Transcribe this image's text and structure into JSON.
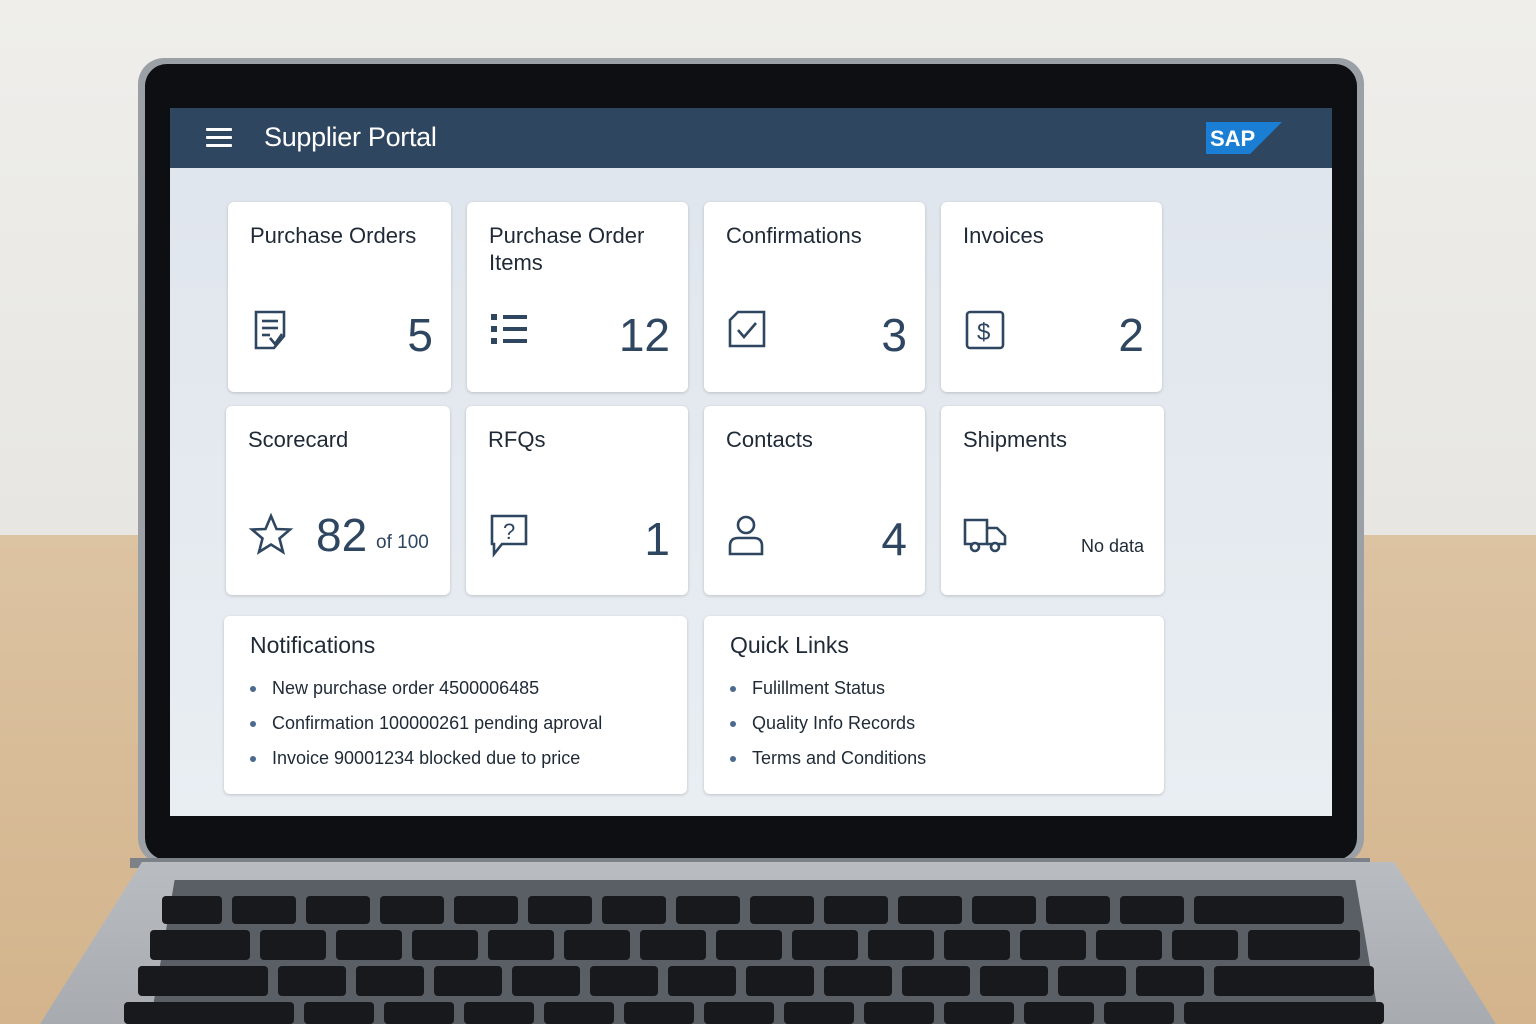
{
  "app": {
    "title": "Supplier Portal",
    "logo_text": "SAP"
  },
  "tiles_row1": [
    {
      "title": "Purchase Orders",
      "value": "5",
      "icon": "document-icon"
    },
    {
      "title": "Purchase Order Items",
      "value": "12",
      "icon": "list-icon"
    },
    {
      "title": "Confirmations",
      "value": "3",
      "icon": "checkbox-icon"
    },
    {
      "title": "Invoices",
      "value": "2",
      "icon": "dollar-icon"
    }
  ],
  "tiles_row2": [
    {
      "title": "Scorecard",
      "value": "82",
      "suffix": "of 100",
      "icon": "star-icon"
    },
    {
      "title": "RFQs",
      "value": "1",
      "icon": "question-bubble-icon"
    },
    {
      "title": "Contacts",
      "value": "4",
      "icon": "person-icon"
    },
    {
      "title": "Shipments",
      "value": "No data",
      "icon": "truck-icon"
    }
  ],
  "notifications": {
    "title": "Notifications",
    "items": [
      "New purchase order 4500006485",
      "Confirmation 100000261 pending aproval",
      "Invoice 90001234 blocked due to price"
    ]
  },
  "quick_links": {
    "title": "Quick Links",
    "items": [
      "Fulillment Status",
      "Quality Info Records",
      "Terms and Conditions"
    ]
  },
  "colors": {
    "shellbar": "#2f4661",
    "accent": "#2f4661",
    "sap_blue": "#1a7fd4"
  }
}
